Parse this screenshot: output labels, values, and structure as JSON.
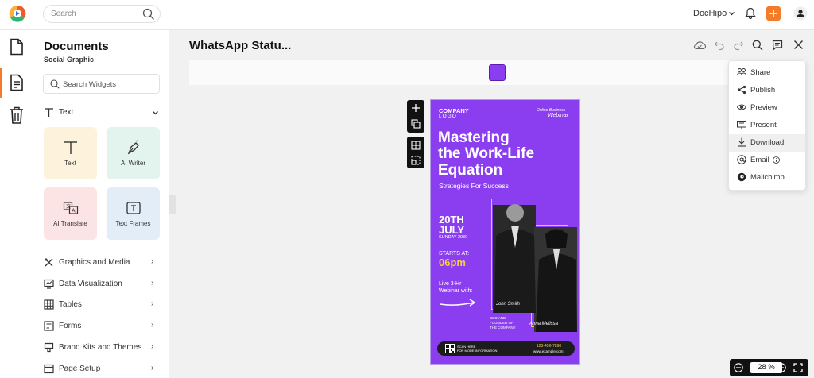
{
  "header": {
    "search_placeholder": "Search",
    "brand": "DocHipo"
  },
  "panel": {
    "title": "Documents",
    "subtitle": "Social Graphic",
    "widget_search_placeholder": "Search Widgets",
    "text_section": "Text",
    "tiles": [
      {
        "label": "Text",
        "color": "#fdf3dd"
      },
      {
        "label": "AI Writer",
        "color": "#e3f4ef"
      },
      {
        "label": "AI Translate",
        "color": "#fde4e4"
      },
      {
        "label": "Text Frames",
        "color": "#e3edf8"
      }
    ],
    "sections": [
      "Graphics and Media",
      "Data Visualization",
      "Tables",
      "Forms",
      "Brand Kits and Themes",
      "Page Setup"
    ]
  },
  "document": {
    "title": "WhatsApp Statu...",
    "swatch_color": "#8b3ef0"
  },
  "poster": {
    "company": "COMPANY",
    "logo": "LOGO",
    "online": "Online Business",
    "webinar": "Webinar",
    "headline": [
      "Mastering",
      "the Work-Life",
      "Equation"
    ],
    "tagline": "Strategies For Success",
    "date_line1": "20TH",
    "date_line2": "JULY",
    "date_sub": "SUNDAY 2030",
    "starts_label": "STARTS AT:",
    "starts_time": "06pm",
    "live_line1": "Live 3-Hr",
    "live_line2": "Webinar with:",
    "speaker1": "John Smith",
    "speaker2": "Anna Melissa",
    "role": [
      "CEO AND",
      "FOUNDER OF",
      "THE COMPANY"
    ],
    "scan1": "SCAN HERE",
    "scan2": "FOR MORE INFORMATION",
    "phone": "123-456-7890",
    "site": "www.example.com",
    "accent": "#f7c948"
  },
  "share_menu": [
    {
      "label": "Share",
      "icon": "share-icon"
    },
    {
      "label": "Publish",
      "icon": "publish-icon"
    },
    {
      "label": "Preview",
      "icon": "eye-icon"
    },
    {
      "label": "Present",
      "icon": "present-icon"
    },
    {
      "label": "Download",
      "icon": "download-icon"
    },
    {
      "label": "Email",
      "icon": "at-icon"
    },
    {
      "label": "Mailchimp",
      "icon": "mailchimp-icon"
    }
  ],
  "zoom": {
    "value": "28",
    "unit": "%"
  }
}
